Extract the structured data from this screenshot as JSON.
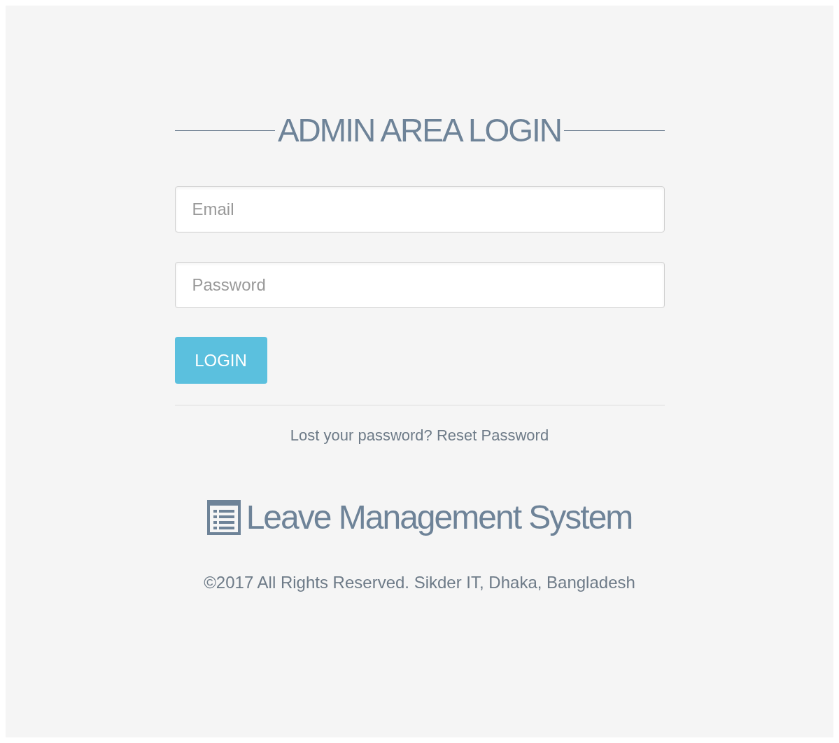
{
  "title": "ADMIN AREA LOGIN",
  "email_field": {
    "placeholder": "Email"
  },
  "password_field": {
    "placeholder": "Password"
  },
  "login_button": "LOGIN",
  "reset": {
    "text": "Lost your password?",
    "link": "Reset Password"
  },
  "brand": "Leave Management System",
  "copyright": "©2017 All Rights Reserved. Sikder IT, Dhaka, Bangladesh"
}
